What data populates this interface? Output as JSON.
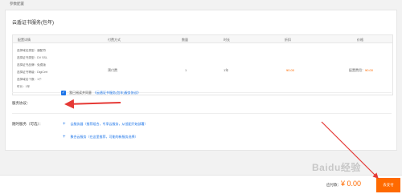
{
  "page": {
    "top_label": "参数配置"
  },
  "section": {
    "title": "云盾证书服务(包年)"
  },
  "table": {
    "headers": [
      "配置详情",
      "付费方式",
      "数量",
      "时长",
      "折扣",
      "价格"
    ],
    "details": [
      "选择域名类型：通配符",
      "选择证书类型：DV SSL",
      "选择证书品牌：免费版",
      "选择证书等级：DigiCert",
      "选择域名个数：1个",
      "时长：1年"
    ],
    "payment": "预付费",
    "quantity": "1",
    "duration": "1年",
    "discount": "¥0.00",
    "price_label": "配置费用：",
    "price_value": "¥0.00"
  },
  "agreement": {
    "label": "服务协议：",
    "text": "我已阅读并同意",
    "link": "《云盾证书服务(包年)服务协议》"
  },
  "extras": {
    "label": "随时服务（可选）：",
    "items": [
      "云服务器（推荐组合，专享云服务，从低配开始部署）",
      "聚合云服务（在这里推荐，可能的新服务选择）"
    ]
  },
  "footer": {
    "pay_label": "应付款：",
    "pay_amount": "¥ 0.00",
    "pay_button": "去支付"
  },
  "watermark": "Baidu经验"
}
